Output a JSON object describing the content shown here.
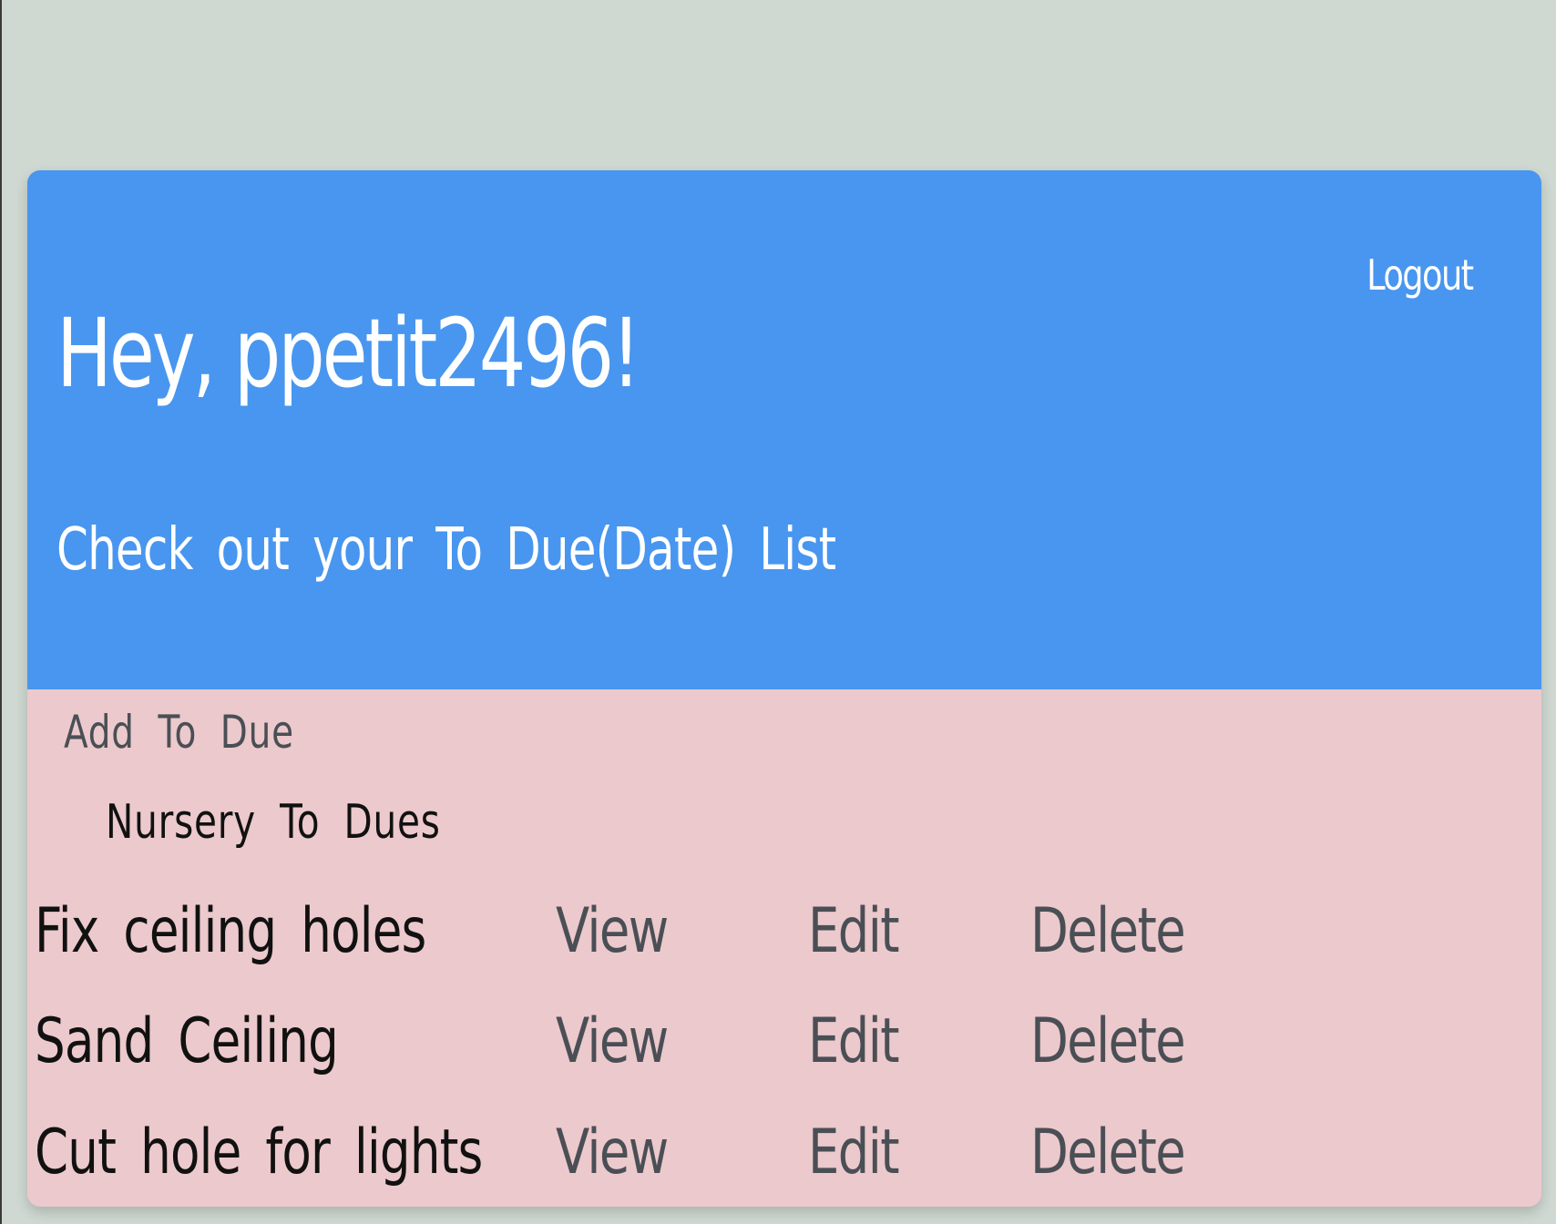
{
  "header": {
    "greeting": "Hey, ppetit2496!",
    "subtitle": "Check out your To Due(Date) List",
    "logout_label": "Logout"
  },
  "content": {
    "add_label": "Add To Due",
    "section_title": "Nursery To Dues",
    "items": [
      {
        "task": "Fix ceiling holes",
        "view": "View",
        "edit": "Edit",
        "delete": "Delete"
      },
      {
        "task": "Sand Ceiling",
        "view": "View",
        "edit": "Edit",
        "delete": "Delete"
      },
      {
        "task": "Cut hole for lights",
        "view": "View",
        "edit": "Edit",
        "delete": "Delete"
      }
    ]
  },
  "colors": {
    "page_background": "#cfd9d2",
    "header_background": "#4896ef",
    "content_background": "#ecc9cc",
    "action_text": "#4a4f55",
    "task_text": "#111111"
  }
}
